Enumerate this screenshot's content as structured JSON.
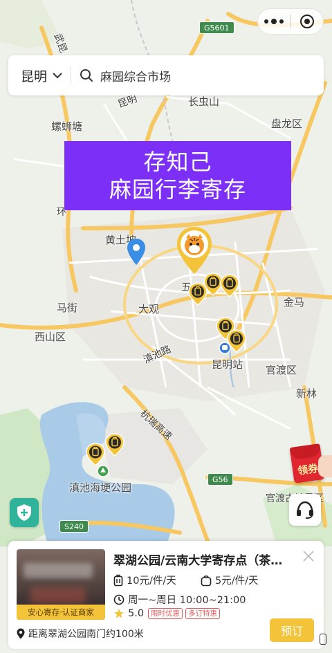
{
  "capsule": {
    "more_icon": "more-dots-icon",
    "close_icon": "target-circle-icon"
  },
  "search": {
    "city": "昆明",
    "query": "麻园综合市场"
  },
  "banner": {
    "line1": "存知己",
    "line2": "麻园行李寄存"
  },
  "map": {
    "places": {
      "changchongshan": "长虫山",
      "panlongqu": "盘龙区",
      "luositang": "螺蛳塘",
      "huangtupo": "黄土坡",
      "wuhua": "五",
      "majie": "马街",
      "daguan": "大观",
      "jinma": "金马",
      "xishanqu": "西山区",
      "kunmingzhan": "昆明站",
      "guanduqu": "官渡区",
      "xinlin": "新林",
      "dianchi_park": "滇池海埂公园",
      "guandu_bottom": "官渡古镇景区"
    },
    "roads": {
      "dianchi_road": "滇池路",
      "hangrui": "杭瑞高速",
      "wudu": "武昆",
      "kunming_n": "昆明",
      "huan": "环"
    },
    "shields": {
      "g5601": "G5601",
      "g56": "G56",
      "s240": "S240"
    },
    "colors": {
      "water": "#a9cbe8",
      "park": "#cfe7c4",
      "highway": "#f7c862",
      "road": "#ffffff",
      "marker": "#f3c43a"
    }
  },
  "coupon": {
    "label": "领券"
  },
  "card": {
    "title": "翠湖公园/云南大学寄存点（茶…",
    "badge": "安心寄存·认证商家",
    "price_large": "10元/件/天",
    "price_small": "5元/件/天",
    "hours": "周一~周日 10:00~21:00",
    "rating": "5.0",
    "tag1": "限时优惠",
    "tag2": "多订特惠",
    "distance": "距离翠湖公园南门约100米",
    "book_label": "预订"
  }
}
